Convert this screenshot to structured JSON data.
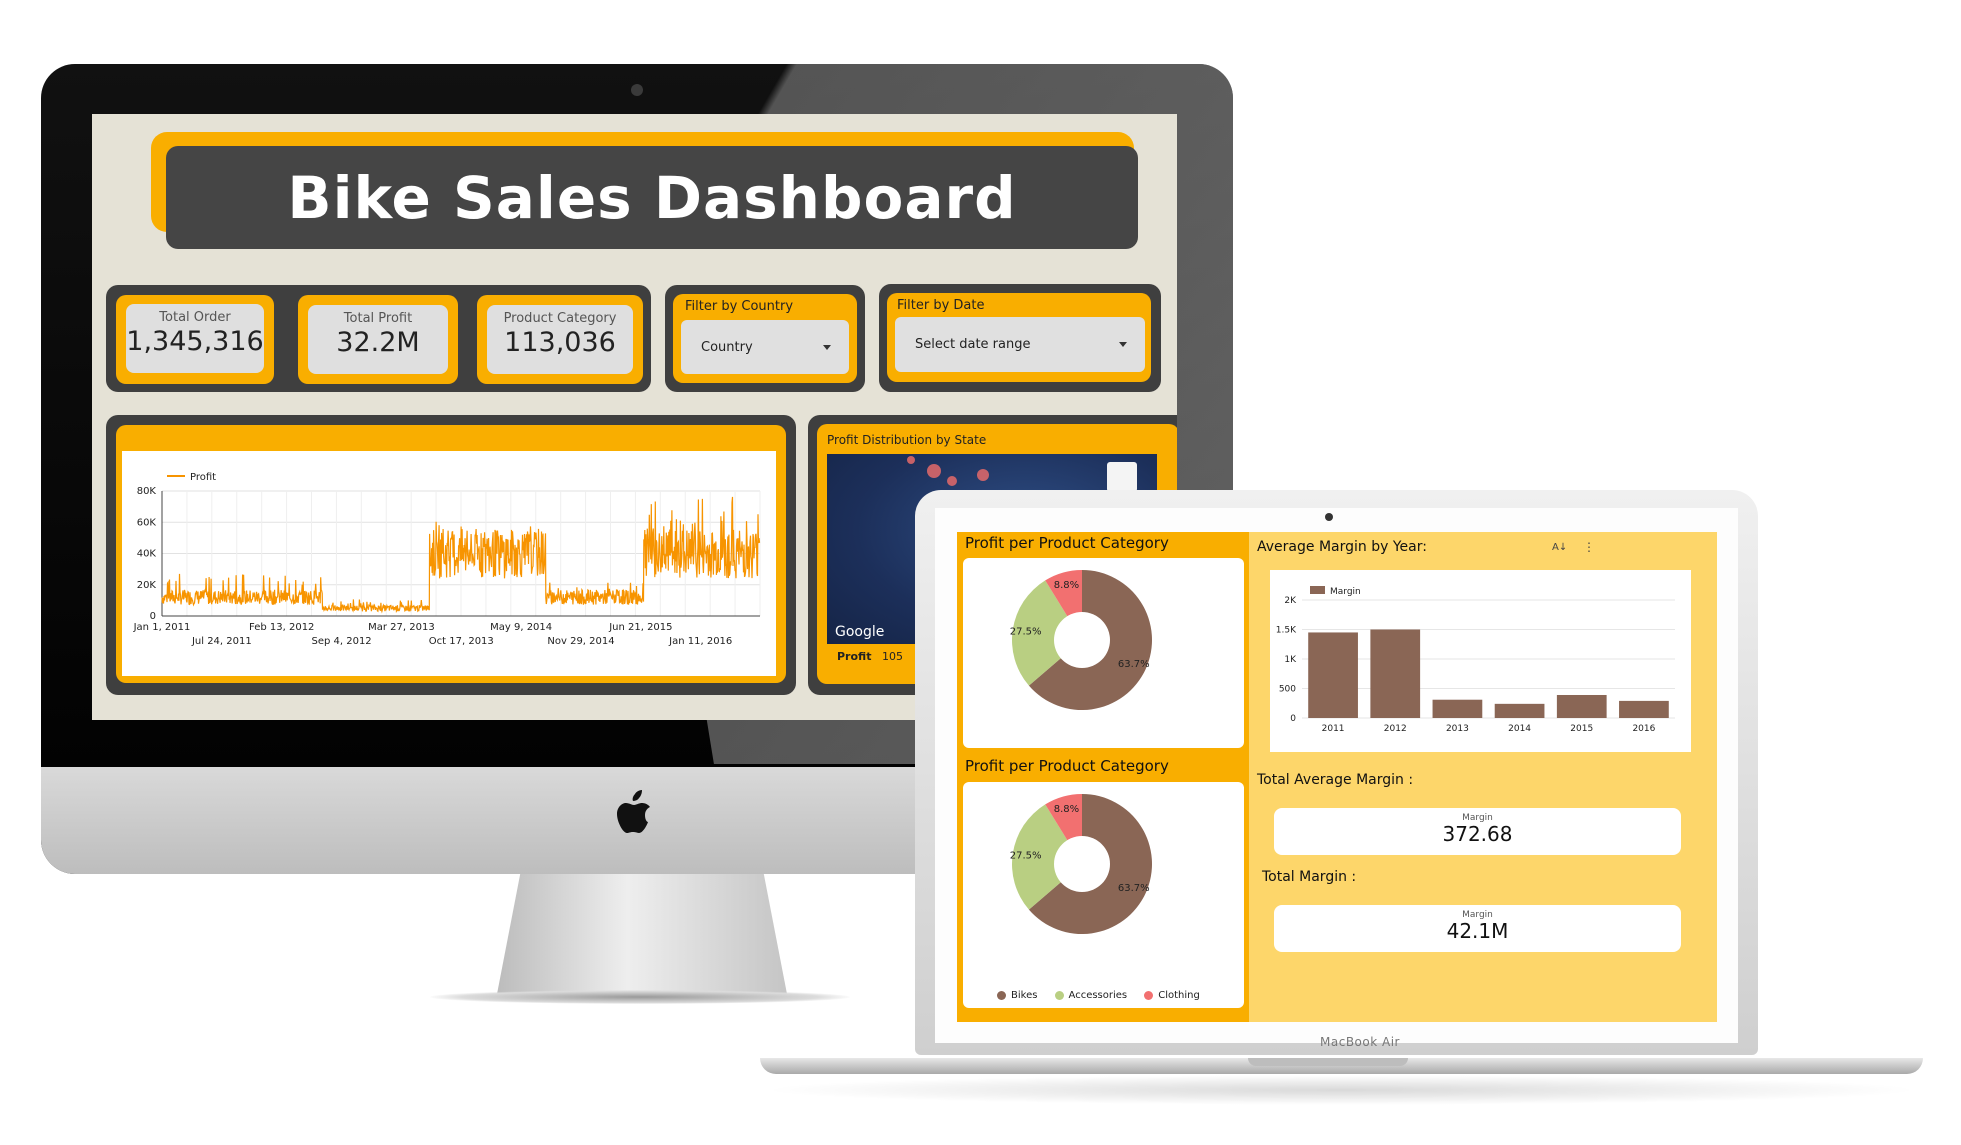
{
  "dashboard": {
    "title": "Bike Sales Dashboard",
    "kpis": [
      {
        "label": "Total Order",
        "value": "1,345,316"
      },
      {
        "label": "Total Profit",
        "value": "32.2M"
      },
      {
        "label": "Product Category",
        "value": "113,036"
      }
    ],
    "filters": {
      "country": {
        "title": "Filter by Country",
        "value": "Country"
      },
      "date": {
        "title": "Filter by Date",
        "value": "Select date range"
      }
    },
    "map": {
      "title": "Profit Distribution by State",
      "google_label": "Google",
      "footer_label": "Profit",
      "footer_value": "105"
    }
  },
  "laptop": {
    "label": "MacBook Air",
    "pie_title_top": "Profit per Product Category",
    "pie_title_bottom": "Profit per Product Category",
    "bar_title": "Average Margin by Year:",
    "total_avg": {
      "title": "Total Average Margin :",
      "label": "Margin",
      "value": "372.68"
    },
    "total_margin": {
      "title": "Total Margin :",
      "label": "Margin",
      "value": "42.1M"
    }
  },
  "colors": {
    "orange": "#f9ae00",
    "dark": "#454545",
    "bikes": "#8a6655",
    "accessories": "#b9cf82",
    "clothing": "#f27070",
    "line": "#f79400"
  },
  "chart_data": [
    {
      "id": "profit-timeseries",
      "type": "line",
      "legend": [
        "Profit"
      ],
      "y_ticks": [
        "0",
        "20K",
        "40K",
        "60K",
        "80K"
      ],
      "ylim": [
        0,
        80000
      ],
      "x_ticks_row1": [
        "Jan 1, 2011",
        "Feb 13, 2012",
        "Mar 27, 2013",
        "May 9, 2014",
        "Jun 21, 2015"
      ],
      "x_ticks_row2": [
        "Jul 24, 2011",
        "Sep 4, 2012",
        "Oct 17, 2013",
        "Nov 29, 2014",
        "Jan 11, 2016"
      ],
      "series": [
        {
          "name": "Profit",
          "x_start": "2011-01-01",
          "x_end": "2016-07-31",
          "segments": [
            {
              "from": "2011-01-01",
              "to": "2012-06-30",
              "level": 12000,
              "spike": 25000
            },
            {
              "from": "2012-07-01",
              "to": "2013-06-30",
              "level": 5000,
              "spike": 10000
            },
            {
              "from": "2013-07-01",
              "to": "2014-07-31",
              "level": 40000,
              "spike": 55000
            },
            {
              "from": "2014-08-01",
              "to": "2015-06-30",
              "level": 12000,
              "spike": 20000
            },
            {
              "from": "2015-07-01",
              "to": "2016-07-31",
              "level": 40000,
              "spike": 70000
            }
          ]
        }
      ]
    },
    {
      "id": "pie-top",
      "type": "pie",
      "categories": [
        "Bikes",
        "Accessories",
        "Clothing"
      ],
      "values": [
        63.7,
        27.5,
        8.8
      ],
      "labels": [
        "63.7%",
        "27.5%",
        "8.8%"
      ]
    },
    {
      "id": "pie-bottom",
      "type": "pie",
      "categories": [
        "Bikes",
        "Accessories",
        "Clothing"
      ],
      "values": [
        63.7,
        27.5,
        8.8
      ],
      "labels": [
        "63.7%",
        "27.5%",
        "8.8%"
      ],
      "legend": [
        "Bikes",
        "Accessories",
        "Clothing"
      ]
    },
    {
      "id": "margin-bars",
      "type": "bar",
      "legend": [
        "Margin"
      ],
      "categories": [
        "2011",
        "2012",
        "2013",
        "2014",
        "2015",
        "2016"
      ],
      "values": [
        1450,
        1500,
        310,
        240,
        390,
        290
      ],
      "y_ticks": [
        "0",
        "500",
        "1K",
        "1.5K",
        "2K"
      ],
      "ylim": [
        0,
        2000
      ]
    }
  ]
}
